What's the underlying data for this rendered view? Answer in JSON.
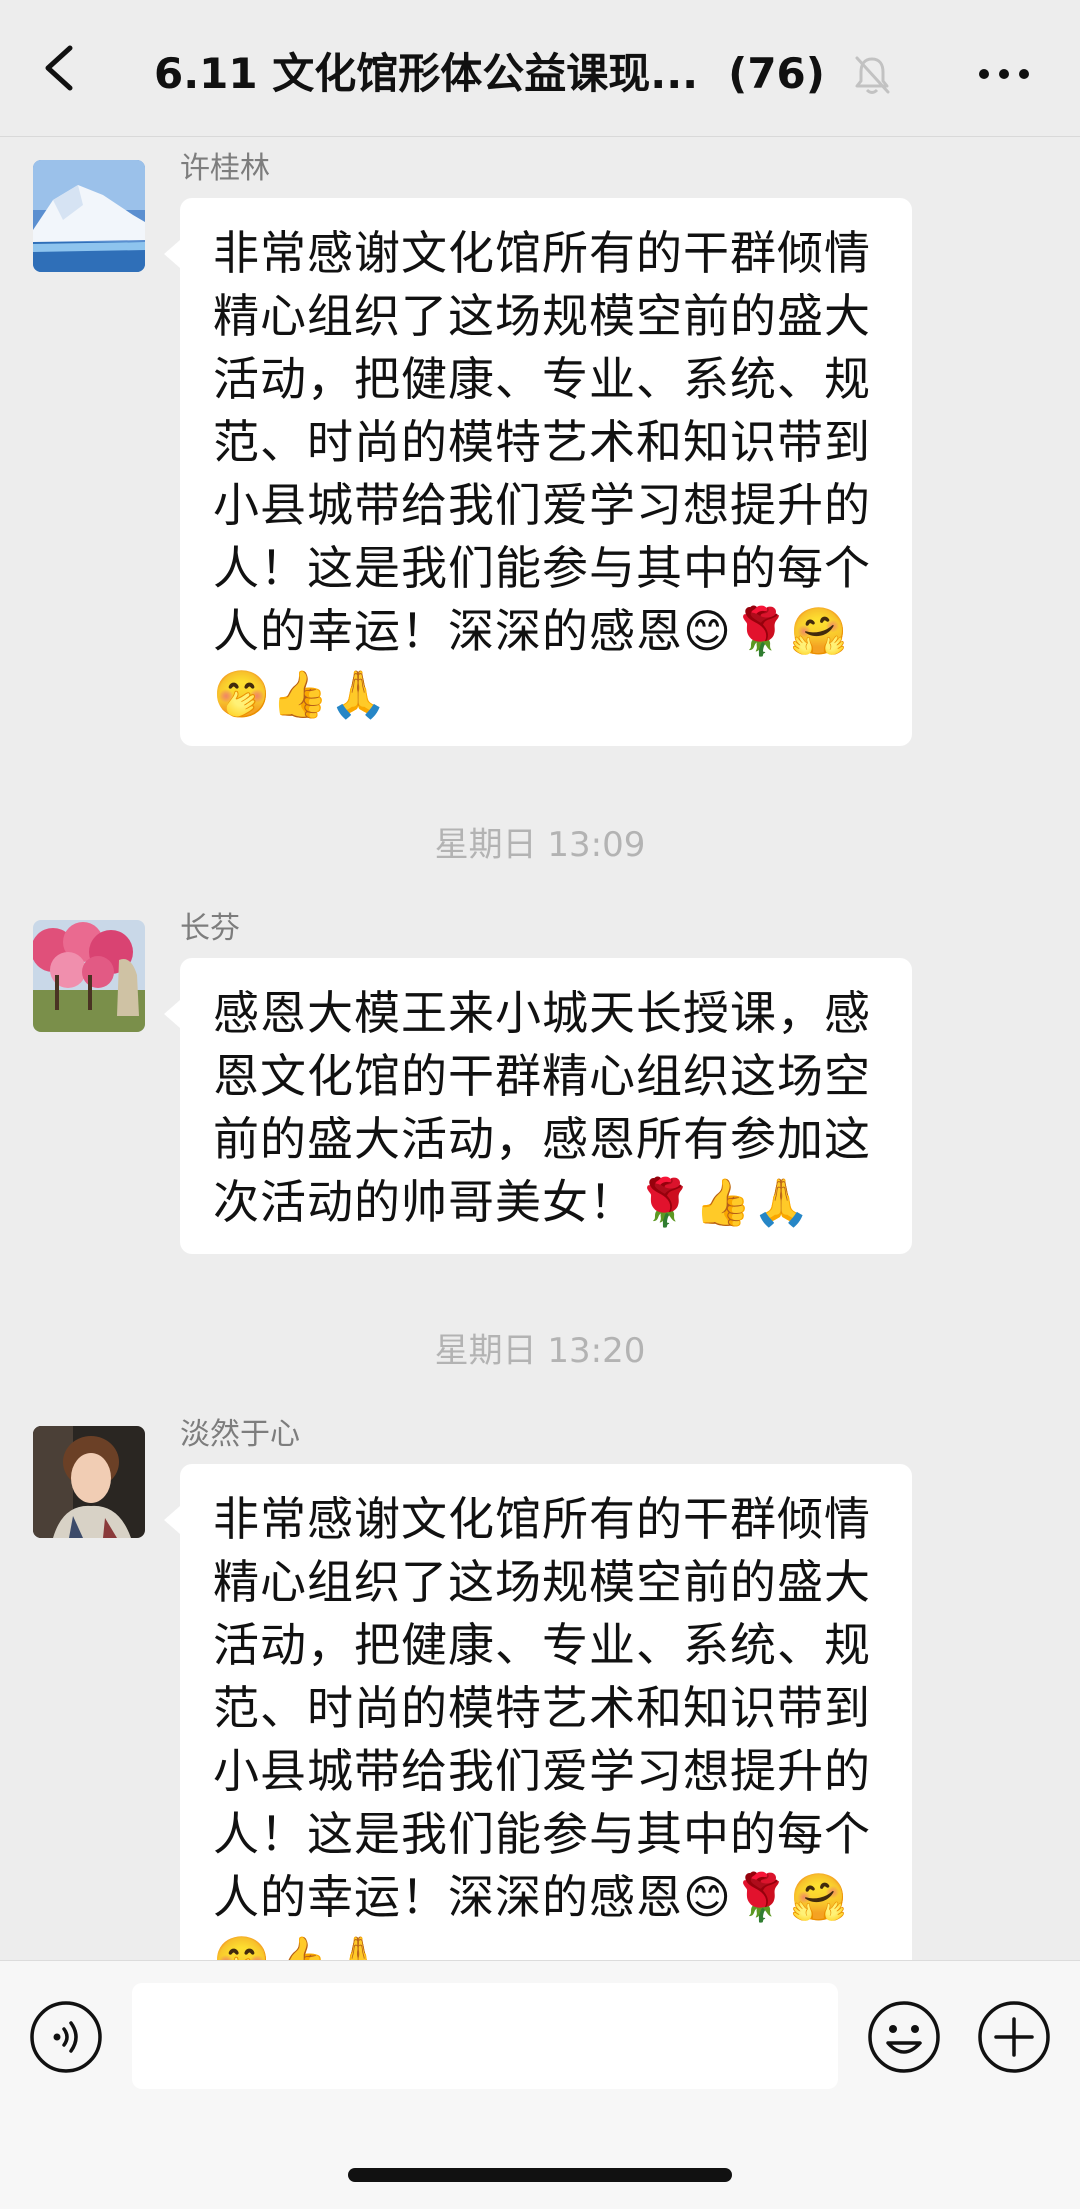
{
  "header": {
    "title": "6.11 文化馆形体公益课现...",
    "member_count": "(76)",
    "back_icon": "chevron-left-icon",
    "mute_icon": "bell-muted-icon",
    "more_icon": "more-dots-icon"
  },
  "messages": [
    {
      "sender": "许桂林",
      "avatar": "iceberg-photo",
      "text": "非常感谢文化馆所有的干群倾情精心组织了这场规模空前的盛大活动，把健康、专业、系统、规范、时尚的模特艺术和知识带到小县城带给我们爱学习想提升的人！这是我们能参与其中的每个人的幸运！深深的感恩😊🌹🤗🤭👍🙏"
    },
    {
      "sender": "长芬",
      "avatar": "peach-blossom-photo",
      "text": "感恩大模王来小城天长授课，感恩文化馆的干群精心组织这场空前的盛大活动，感恩所有参加这次活动的帅哥美女！🌹👍🙏"
    },
    {
      "sender": "淡然于心",
      "avatar": "portrait-photo",
      "text": "非常感谢文化馆所有的干群倾情精心组织了这场规模空前的盛大活动，把健康、专业、系统、规范、时尚的模特艺术和知识带到小县城带给我们爱学习想提升的人！这是我们能参与其中的每个人的幸运！深深的感恩😊🌹🤗🤭👍🙏"
    }
  ],
  "timestamps": [
    "星期日 13:09",
    "星期日 13:20"
  ],
  "input_bar": {
    "voice_icon": "voice-icon",
    "emoji_icon": "emoji-icon",
    "plus_icon": "plus-icon",
    "placeholder": ""
  }
}
